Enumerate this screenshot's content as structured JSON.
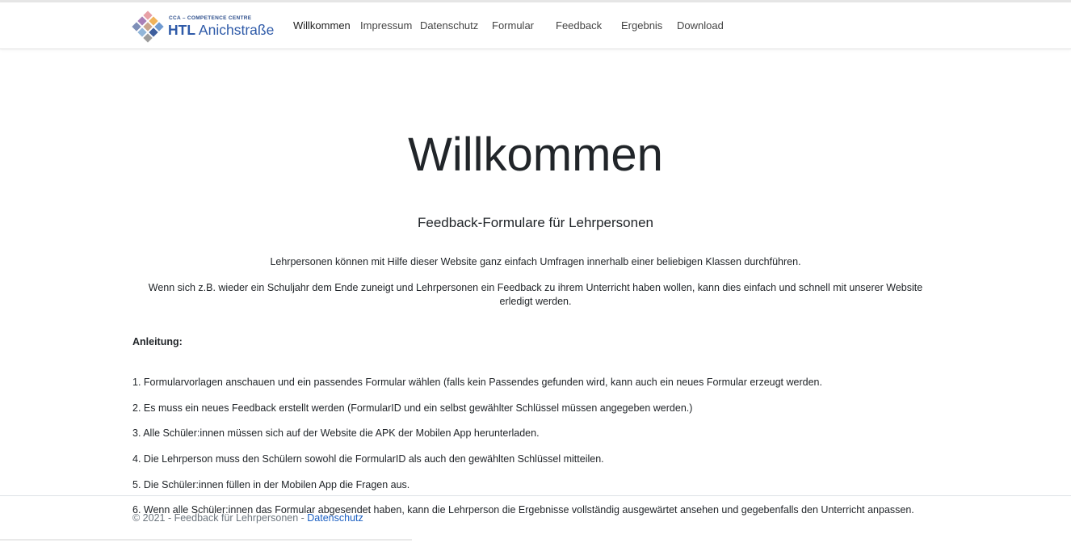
{
  "brand": {
    "small_text": "CCA – COMPETENCE CENTRE",
    "name_bold": "HTL",
    "name_rest": " Anichstraße"
  },
  "nav": {
    "items": [
      {
        "label": "Willkommen"
      },
      {
        "label": "Impressum"
      },
      {
        "label": "Datenschutz"
      },
      {
        "label": "Formular"
      },
      {
        "label": "Feedback"
      },
      {
        "label": "Ergebnis"
      },
      {
        "label": "Download"
      }
    ]
  },
  "main": {
    "title": "Willkommen",
    "subtitle": "Feedback-Formulare für Lehrpersonen",
    "intro1": "Lehrpersonen können mit Hilfe dieser Website ganz einfach Umfragen innerhalb einer beliebigen Klassen durchführen.",
    "intro2": "Wenn sich z.B. wieder ein Schuljahr dem Ende zuneigt und Lehrpersonen ein Feedback zu ihrem Unterricht haben wollen, kann dies einfach und schnell mit unserer Website erledigt werden.",
    "instructions_heading": "Anleitung:",
    "steps": [
      "1. Formularvorlagen anschauen und ein passendes Formular wählen (falls kein Passendes gefunden wird, kann auch ein neues Formular erzeugt werden.",
      "2. Es muss ein neues Feedback erstellt werden (FormularID und ein selbst gewählter Schlüssel müssen angegeben werden.)",
      "3. Alle Schüler:innen müssen sich auf der Website die APK der Mobilen App herunterladen.",
      "4. Die Lehrperson muss den Schülern sowohl die FormularID als auch den gewählten Schlüssel mitteilen.",
      "5. Die Schüler:innen füllen in der Mobilen App die Fragen aus.",
      "6. Wenn alle Schüler:innen das Formular abgesendet haben, kann die Lehrperson die Ergebnisse vollständig ausgewärtet ansehen und gegebenfalls den Unterricht anpassen."
    ]
  },
  "footer": {
    "copyright": "© 2021 - Feedback für Lehrpersonen - ",
    "link_label": "Datenschutz"
  },
  "colors": {
    "link": "#1a5fc2",
    "brand_blue": "#2e5aa8",
    "text": "#212529",
    "muted": "#6c757d"
  }
}
